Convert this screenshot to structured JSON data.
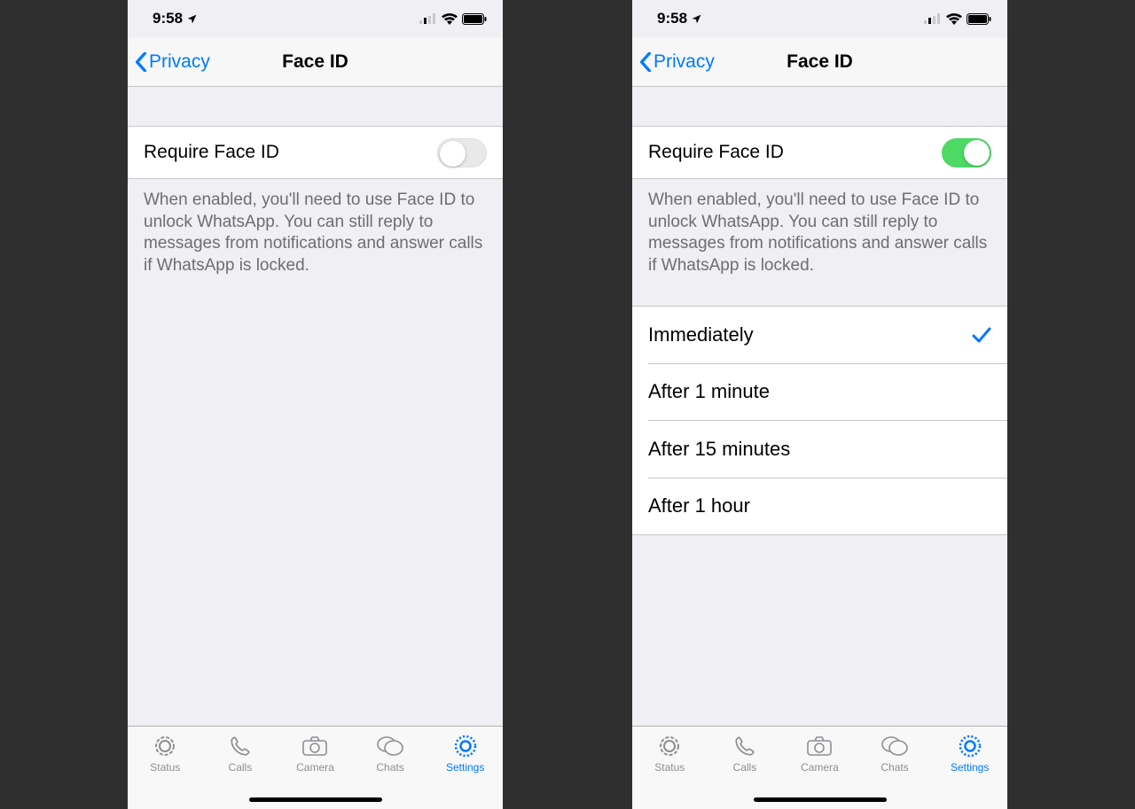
{
  "status": {
    "time": "9:58"
  },
  "nav": {
    "back": "Privacy",
    "title": "Face ID"
  },
  "require": {
    "label": "Require Face ID"
  },
  "footer": "When enabled, you'll need to use Face ID to unlock WhatsApp. You can still reply to messages from notifications and answer calls if WhatsApp is locked.",
  "phones": [
    {
      "toggle_on": false,
      "show_options": false
    },
    {
      "toggle_on": true,
      "show_options": true,
      "selected": 0
    }
  ],
  "options": [
    "Immediately",
    "After 1 minute",
    "After 15 minutes",
    "After 1 hour"
  ],
  "tabs": [
    {
      "label": "Status"
    },
    {
      "label": "Calls"
    },
    {
      "label": "Camera"
    },
    {
      "label": "Chats"
    },
    {
      "label": "Settings"
    }
  ],
  "active_tab": 4
}
